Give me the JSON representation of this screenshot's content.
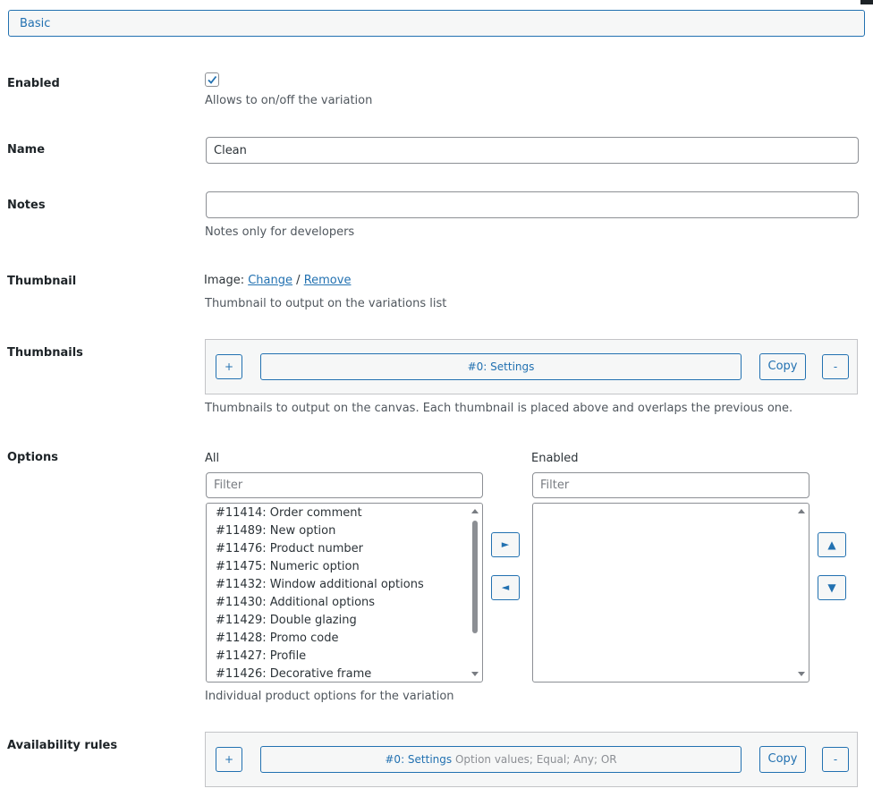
{
  "section_tab": {
    "label": "Basic"
  },
  "enabled": {
    "label": "Enabled",
    "checked": true,
    "description": "Allows to on/off the variation"
  },
  "name": {
    "label": "Name",
    "value": "Clean"
  },
  "notes": {
    "label": "Notes",
    "value": "",
    "description": "Notes only for developers"
  },
  "thumbnail": {
    "label": "Thumbnail",
    "image_prefix": "Image:",
    "change_link": "Change",
    "separator": "/",
    "remove_link": "Remove",
    "description": "Thumbnail to output on the variations list"
  },
  "thumbnails": {
    "label": "Thumbnails",
    "add_label": "+",
    "item_label": "#0: Settings",
    "copy_label": "Copy",
    "remove_label": "-",
    "description": "Thumbnails to output on the canvas. Each thumbnail is placed above and overlaps the previous one."
  },
  "options": {
    "label": "Options",
    "all_label": "All",
    "enabled_label": "Enabled",
    "filter_placeholder": "Filter",
    "move_right_label": "►",
    "move_left_label": "◄",
    "up_label": "▲",
    "down_label": "▼",
    "all_items": [
      "#11414: Order comment",
      "#11489: New option",
      "#11476: Product number",
      "#11475: Numeric option",
      "#11432: Window additional options",
      "#11430: Additional options",
      "#11429: Double glazing",
      "#11428: Promo code",
      "#11427: Profile",
      "#11426: Decorative frame"
    ],
    "description": "Individual product options for the variation"
  },
  "availability_rules": {
    "label": "Availability rules",
    "add_label": "+",
    "item_label": "#0: Settings",
    "item_detail": "Option values; Equal; Any; OR",
    "copy_label": "Copy",
    "remove_label": "-"
  },
  "colors": {
    "accent": "#2271b1",
    "border": "#8c8f94",
    "panel": "#f6f7f7"
  }
}
